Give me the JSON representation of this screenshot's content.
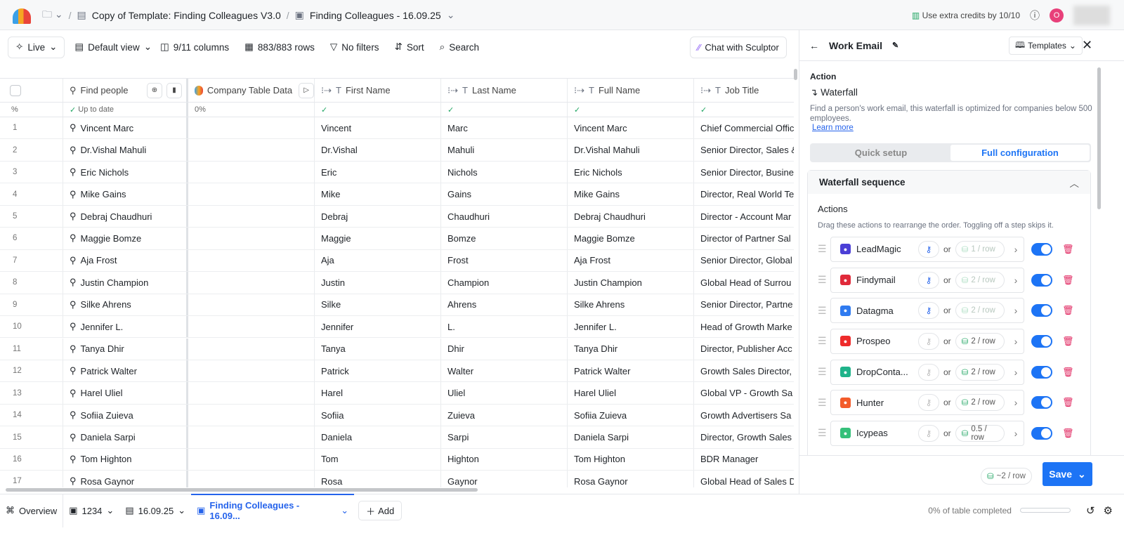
{
  "topbar": {
    "breadcrumb_workbook": "Copy of Template: Finding Colleagues V3.0",
    "breadcrumb_table": "Finding Colleagues - 16.09.25",
    "credits": "Use extra credits by 10/10",
    "avatar_initial": "O"
  },
  "toolbar": {
    "live": "Live",
    "view": "Default view",
    "columns": "9/11 columns",
    "rows": "883/883 rows",
    "filters": "No filters",
    "sort": "Sort",
    "search": "Search",
    "sculptor": "Chat with Sculptor"
  },
  "table": {
    "headers": [
      "Find people",
      "Company Table Data",
      "First Name",
      "Last Name",
      "Full Name",
      "Job Title"
    ],
    "status": {
      "index": "%",
      "find_people": "Up to date",
      "company": "0%"
    },
    "rows": [
      [
        "1",
        "Vincent Marc",
        "Vincent",
        "Marc",
        "Vincent Marc",
        "Chief Commercial Offic"
      ],
      [
        "2",
        "Dr.Vishal Mahuli",
        "Dr.Vishal",
        "Mahuli",
        "Dr.Vishal Mahuli",
        "Senior Director, Sales &"
      ],
      [
        "3",
        "Eric Nichols",
        "Eric",
        "Nichols",
        "Eric Nichols",
        "Senior Director, Busine"
      ],
      [
        "4",
        "Mike Gains",
        "Mike",
        "Gains",
        "Mike Gains",
        "Director, Real World Te"
      ],
      [
        "5",
        "Debraj Chaudhuri",
        "Debraj",
        "Chaudhuri",
        "Debraj Chaudhuri",
        "Director - Account Mar"
      ],
      [
        "6",
        "Maggie Bomze",
        "Maggie",
        "Bomze",
        "Maggie Bomze",
        "Director of Partner Sal"
      ],
      [
        "7",
        "Aja Frost",
        "Aja",
        "Frost",
        "Aja Frost",
        "Senior Director, Global"
      ],
      [
        "8",
        "Justin Champion",
        "Justin",
        "Champion",
        "Justin Champion",
        "Global Head of Surrou"
      ],
      [
        "9",
        "Silke Ahrens",
        "Silke",
        "Ahrens",
        "Silke Ahrens",
        "Senior Director, Partne"
      ],
      [
        "10",
        "Jennifer L.",
        "Jennifer",
        "L.",
        "Jennifer L.",
        "Head of Growth Marke"
      ],
      [
        "11",
        "Tanya Dhir",
        "Tanya",
        "Dhir",
        "Tanya Dhir",
        "Director, Publisher Acc"
      ],
      [
        "12",
        "Patrick Walter",
        "Patrick",
        "Walter",
        "Patrick Walter",
        "Growth Sales Director,"
      ],
      [
        "13",
        "Harel Uliel",
        "Harel",
        "Uliel",
        "Harel Uliel",
        "Global VP - Growth Sa"
      ],
      [
        "14",
        "Sofiia Zuieva",
        "Sofiia",
        "Zuieva",
        "Sofiia Zuieva",
        "Growth Advertisers Sa"
      ],
      [
        "15",
        "Daniela Sarpi",
        "Daniela",
        "Sarpi",
        "Daniela Sarpi",
        "Director, Growth Sales"
      ],
      [
        "16",
        "Tom Highton",
        "Tom",
        "Highton",
        "Tom Highton",
        "BDR Manager"
      ],
      [
        "17",
        "Rosa Gaynor",
        "Rosa",
        "Gaynor",
        "Rosa Gaynor",
        "Global Head of Sales D"
      ]
    ]
  },
  "bottom": {
    "overview": "Overview",
    "workbook": "1234",
    "table": "16.09.25",
    "active_tab": "Finding Colleagues - 16.09...",
    "add": "Add",
    "progress_text": "0% of table completed",
    "progress": 0
  },
  "panel": {
    "title": "Work Email",
    "templates": "Templates",
    "action_label": "Action",
    "action_name": "Waterfall",
    "description": "Find a person's work email, this waterfall is optimized for companies below 500 employees.",
    "learn_more": "Learn more",
    "tab_quick": "Quick setup",
    "tab_full": "Full configuration",
    "section": "Waterfall sequence",
    "actions_label": "Actions",
    "actions_hint": "Drag these actions to rearrange the order. Toggling off a step skips it.",
    "or": "or",
    "steps": [
      {
        "name": "LeadMagic",
        "cost": "1 / row",
        "color": "#4b3fd6",
        "key_active": true,
        "enabled": true
      },
      {
        "name": "Findymail",
        "cost": "2 / row",
        "color": "#e02a3a",
        "key_active": true,
        "enabled": true
      },
      {
        "name": "Datagma",
        "cost": "2 / row",
        "color": "#2f7bf0",
        "key_active": true,
        "enabled": true
      },
      {
        "name": "Prospeo",
        "cost": "2 / row",
        "color": "#ee2b2b",
        "key_active": false,
        "enabled": true
      },
      {
        "name": "DropConta...",
        "cost": "2 / row",
        "color": "#1fb38a",
        "key_active": false,
        "enabled": true
      },
      {
        "name": "Hunter",
        "cost": "2 / row",
        "color": "#f35b2a",
        "key_active": false,
        "enabled": true
      },
      {
        "name": "Icypeas",
        "cost": "0.5 / row",
        "color": "#35c07a",
        "key_active": false,
        "enabled": true
      }
    ],
    "total_cost": "~2 / row",
    "save": "Save"
  },
  "colors": {
    "accent": "#1d74f5",
    "success": "#1fa562",
    "danger": "#e0245e"
  }
}
